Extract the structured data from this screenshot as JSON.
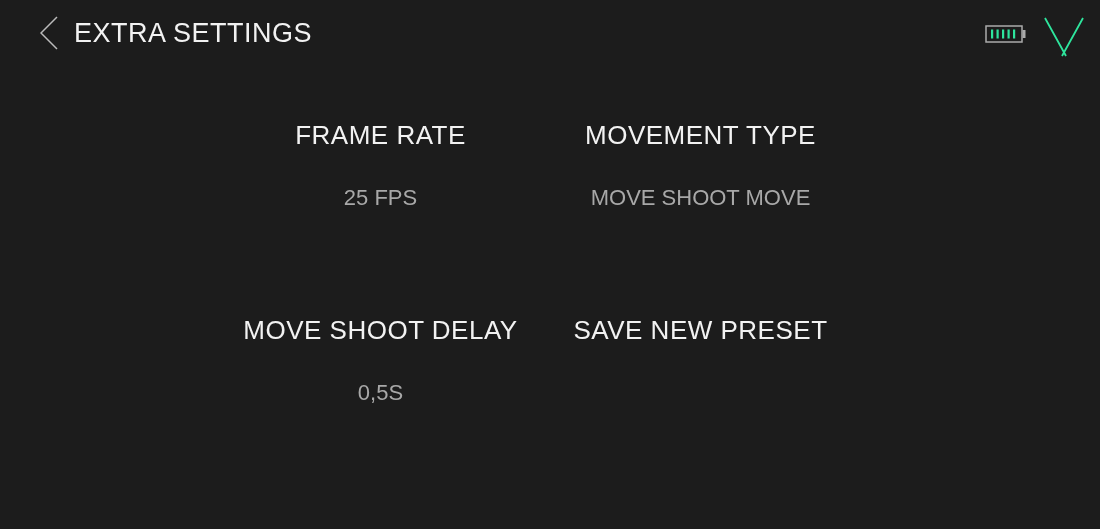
{
  "header": {
    "title": "EXTRA SETTINGS"
  },
  "settings": [
    {
      "label": "FRAME RATE",
      "value": "25 FPS"
    },
    {
      "label": "MOVEMENT TYPE",
      "value": "MOVE SHOOT MOVE"
    },
    {
      "label": "MOVE SHOOT DELAY",
      "value": "0,5S"
    },
    {
      "label": "SAVE NEW PRESET"
    }
  ]
}
